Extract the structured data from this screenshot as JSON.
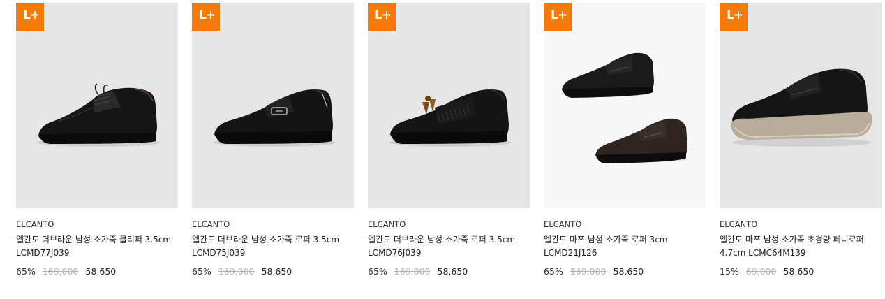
{
  "colors": {
    "badge": "#f47a0b",
    "thumb_bg": "#e6e6e6",
    "thumb_bg_light": "#f7f7f7"
  },
  "products": [
    {
      "badge": "L+",
      "brand": "ELCANTO",
      "name": "엘칸토 더브라운 남성 소가죽 클리퍼 3.5cm LCMD77J039",
      "rate": "65%",
      "original_price": "169,000",
      "sale_price": "58,650",
      "image": "black-derby-shoe"
    },
    {
      "badge": "L+",
      "brand": "ELCANTO",
      "name": "엘칸토 더브라운 남성 소가죽 로퍼 3.5cm LCMD75J039",
      "rate": "65%",
      "original_price": "169,000",
      "sale_price": "58,650",
      "image": "black-penny-loafer"
    },
    {
      "badge": "L+",
      "brand": "ELCANTO",
      "name": "엘칸토 더브라운 남성 소가죽 로퍼 3.5cm LCMD76J039",
      "rate": "65%",
      "original_price": "169,000",
      "sale_price": "58,650",
      "image": "black-tassel-loafer"
    },
    {
      "badge": "L+",
      "brand": "ELCANTO",
      "name": "엘칸토 마쯔 남성 소가죽 로퍼 3cm LCMD21J126",
      "rate": "65%",
      "original_price": "169,000",
      "sale_price": "58,650",
      "image": "black-and-brown-loafers"
    },
    {
      "badge": "L+",
      "brand": "ELCANTO",
      "name": "엘칸토 마쯔 남성 소가죽 초경량 페니로퍼 4.7cm LCMC64M139",
      "rate": "15%",
      "original_price": "69,000",
      "sale_price": "58,650",
      "image": "black-lightweight-penny-loafer"
    }
  ]
}
